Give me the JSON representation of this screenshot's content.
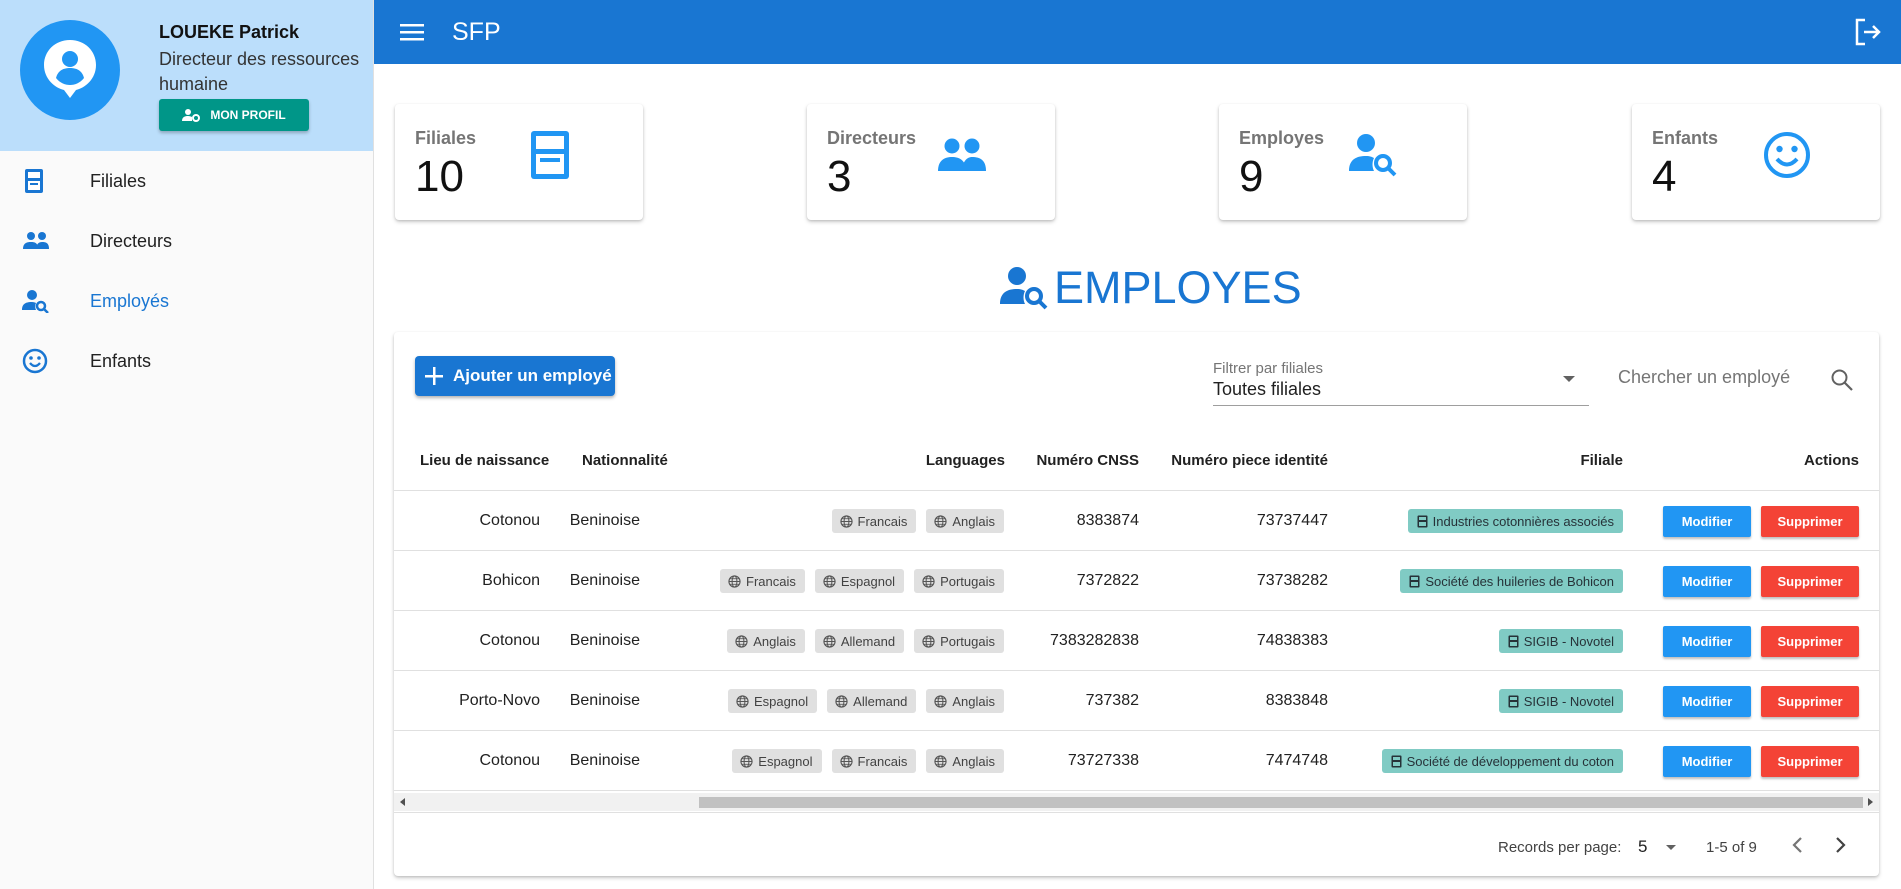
{
  "sidebar": {
    "profile": {
      "name": "LOUEKE Patrick",
      "role": "Directeur des ressources humaine",
      "button_label": "MON PROFIL"
    },
    "items": [
      {
        "label": "Filiales",
        "icon": "building-icon"
      },
      {
        "label": "Directeurs",
        "icon": "people-icon"
      },
      {
        "label": "Employés",
        "icon": "person-search-icon",
        "active": true
      },
      {
        "label": "Enfants",
        "icon": "smiley-icon"
      }
    ]
  },
  "header": {
    "title": "SFP"
  },
  "stats": [
    {
      "title": "Filiales",
      "value": "10",
      "icon": "building-icon"
    },
    {
      "title": "Directeurs",
      "value": "3",
      "icon": "people-icon"
    },
    {
      "title": "Employes",
      "value": "9",
      "icon": "person-search-icon"
    },
    {
      "title": "Enfants",
      "value": "4",
      "icon": "smiley-icon"
    }
  ],
  "section": {
    "title": "EMPLOYES"
  },
  "toolbar": {
    "add_label": "Ajouter un employé",
    "filter_label": "Filtrer par filiales",
    "filter_value": "Toutes filiales",
    "search_placeholder": "Chercher un employé"
  },
  "table": {
    "columns": [
      "Lieu de naissance",
      "Nationnalité",
      "Languages",
      "Numéro CNSS",
      "Numéro piece identité",
      "Filiale",
      "Actions"
    ],
    "rows": [
      {
        "lieu": "Cotonou",
        "nationalite": "Beninoise",
        "languages": [
          "Francais",
          "Anglais"
        ],
        "cnss": "8383874",
        "piece": "73737447",
        "filiale": "Industries cotonnières associés"
      },
      {
        "lieu": "Bohicon",
        "nationalite": "Beninoise",
        "languages": [
          "Francais",
          "Espagnol",
          "Portugais"
        ],
        "cnss": "7372822",
        "piece": "73738282",
        "filiale": "Société des huileries de Bohicon"
      },
      {
        "lieu": "Cotonou",
        "nationalite": "Beninoise",
        "languages": [
          "Anglais",
          "Allemand",
          "Portugais"
        ],
        "cnss": "7383282838",
        "piece": "74838383",
        "filiale": "SIGIB - Novotel"
      },
      {
        "lieu": "Porto-Novo",
        "nationalite": "Beninoise",
        "languages": [
          "Espagnol",
          "Allemand",
          "Anglais"
        ],
        "cnss": "737382",
        "piece": "8383848",
        "filiale": "SIGIB - Novotel"
      },
      {
        "lieu": "Cotonou",
        "nationalite": "Beninoise",
        "languages": [
          "Espagnol",
          "Francais",
          "Anglais"
        ],
        "cnss": "73727338",
        "piece": "7474748",
        "filiale": "Société de développement du coton"
      }
    ],
    "modify_label": "Modifier",
    "delete_label": "Supprimer"
  },
  "pagination": {
    "records_label": "Records per page:",
    "records_value": "5",
    "range": "1-5 of 9"
  },
  "colors": {
    "primary": "#1976d2",
    "profile_bg": "#bbdefb",
    "teal": "#009688",
    "chip_teal": "#80cbc4",
    "modify": "#2196f3",
    "delete": "#f44336"
  }
}
